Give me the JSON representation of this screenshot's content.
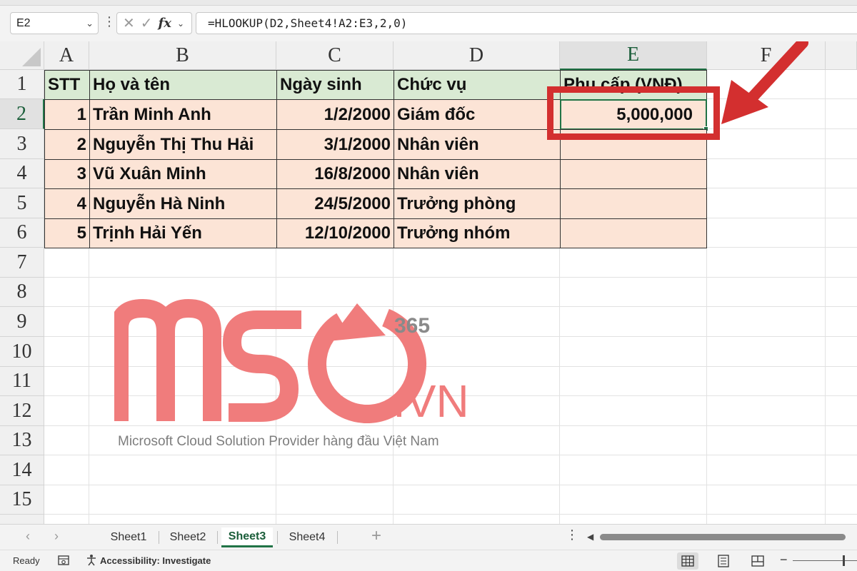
{
  "formula_bar": {
    "name_box": "E2",
    "dots": "⋮",
    "cancel_glyph": "✕",
    "enter_glyph": "✓",
    "fx_label": "fx",
    "formula": "=HLOOKUP(D2,Sheet4!A2:E3,2,0)"
  },
  "columns": [
    "A",
    "B",
    "C",
    "D",
    "E",
    "F"
  ],
  "rows": [
    "1",
    "2",
    "3",
    "4",
    "5",
    "6",
    "7",
    "8",
    "9",
    "10",
    "11",
    "12",
    "13",
    "14",
    "15"
  ],
  "active_cell": "E2",
  "table": {
    "headers": [
      "STT",
      "Họ và tên",
      "Ngày sinh",
      "Chức vụ",
      "Phụ cấp (VNĐ)"
    ],
    "rows": [
      {
        "stt": "1",
        "name": "Trần Minh Anh",
        "dob": "1/2/2000",
        "position": "Giám đốc",
        "allowance": "5,000,000"
      },
      {
        "stt": "2",
        "name": "Nguyễn Thị Thu Hải",
        "dob": "3/1/2000",
        "position": "Nhân viên",
        "allowance": ""
      },
      {
        "stt": "3",
        "name": "Vũ Xuân Minh",
        "dob": "16/8/2000",
        "position": "Nhân viên",
        "allowance": ""
      },
      {
        "stt": "4",
        "name": "Nguyễn Hà Ninh",
        "dob": "24/5/2000",
        "position": "Trưởng phòng",
        "allowance": ""
      },
      {
        "stt": "5",
        "name": "Trịnh Hải Yến",
        "dob": "12/10/2000",
        "position": "Trưởng nhóm",
        "allowance": ""
      }
    ]
  },
  "watermark": {
    "logo_text": "MSO",
    "superscript": "365",
    "suffix": ".VN",
    "tagline": "Microsoft Cloud Solution Provider hàng đầu Việt Nam",
    "color": "#f07c7c"
  },
  "annotation_color": "#d32f2f",
  "sheet_tabs": {
    "prev_icon": "‹",
    "next_icon": "›",
    "tabs": [
      "Sheet1",
      "Sheet2",
      "Sheet3",
      "Sheet4"
    ],
    "active": "Sheet3",
    "add_icon": "+",
    "dots": "⋮"
  },
  "status_bar": {
    "ready": "Ready",
    "accessibility": "Accessibility: Investigate",
    "zoom_minus": "−"
  },
  "colors": {
    "excel_green": "#217346",
    "header_fill": "#d9ead3",
    "body_fill": "#fce4d6"
  }
}
